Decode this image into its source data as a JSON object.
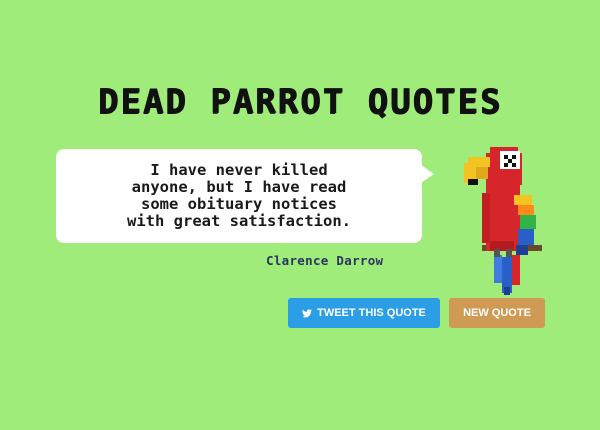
{
  "app": {
    "title": "DEAD PARROT QUOTES"
  },
  "quote": {
    "text": "I have never killed\nanyone, but I have read\nsome obituary notices\nwith great satisfaction.",
    "author": "Clarence Darrow"
  },
  "buttons": {
    "tweet_label": "TWEET THIS QUOTE",
    "new_quote_label": "NEW QUOTE",
    "tweet_icon": "twitter-icon"
  },
  "colors": {
    "background": "#9fec7b",
    "tweet_button": "#2c9ee6",
    "new_quote_button": "#cf9a54",
    "author_text": "#2b3560"
  }
}
